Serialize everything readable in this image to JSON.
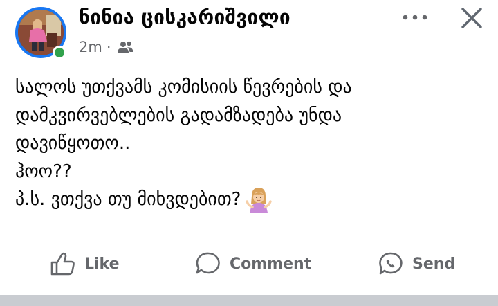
{
  "post": {
    "author": "ნინია ცისკარიშვილი",
    "time": "2m",
    "separator": "·",
    "audience_icon": "friends-icon",
    "text_lines": [
      "სალოს უთქვამს კომისიის წევრების და",
      "დამკვირვებლების გადამზადება უნდა",
      "დავიწყოთო..",
      "ჰოო??",
      "პ.ს. ვთქვა თუ მიხვდებით?"
    ],
    "emoji": "woman-shrugging-emoji"
  },
  "header_icons": {
    "more": "more-options-icon",
    "close": "close-icon"
  },
  "actions": {
    "like": "Like",
    "comment": "Comment",
    "send": "Send"
  },
  "colors": {
    "accent": "#1877f2",
    "online": "#31a24c",
    "muted": "#65676b"
  }
}
